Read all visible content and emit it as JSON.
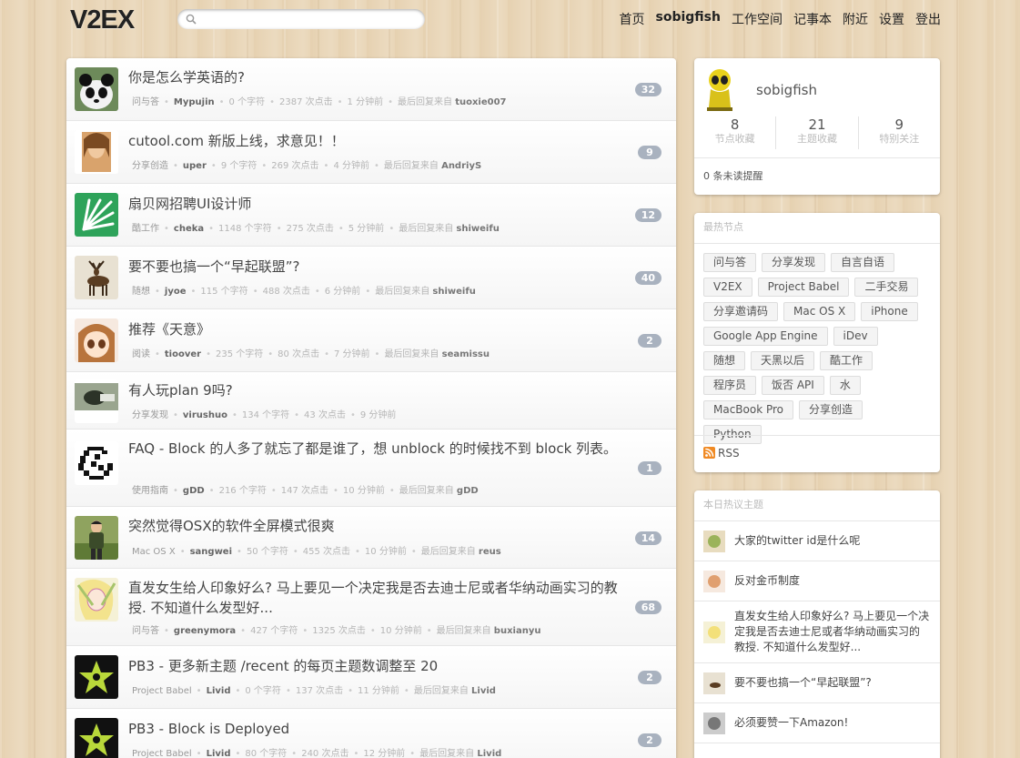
{
  "header": {
    "logo": "V2EX",
    "search_placeholder": "",
    "nav": [
      "首页",
      "sobigfish",
      "工作空间",
      "记事本",
      "附近",
      "设置",
      "登出"
    ]
  },
  "topics": [
    {
      "title": "你是怎么学英语的?",
      "node": "问与答",
      "author": "Mypujin",
      "chars": "0 个字符",
      "clicks": "2387 次点击",
      "time": "1 分钟前",
      "last_label": "最后回复来自",
      "last_user": "tuoxie007",
      "replies": "32"
    },
    {
      "title": "cutool.com 新版上线，求意见！！",
      "node": "分享创造",
      "author": "uper",
      "chars": "9 个字符",
      "clicks": "269 次点击",
      "time": "4 分钟前",
      "last_label": "最后回复来自",
      "last_user": "AndriyS",
      "replies": "9"
    },
    {
      "title": "扇贝网招聘UI设计师",
      "node": "酷工作",
      "author": "cheka",
      "chars": "1148 个字符",
      "clicks": "275 次点击",
      "time": "5 分钟前",
      "last_label": "最后回复来自",
      "last_user": "shiweifu",
      "replies": "12"
    },
    {
      "title": "要不要也搞一个“早起联盟”?",
      "node": "随想",
      "author": "jyoe",
      "chars": "115 个字符",
      "clicks": "488 次点击",
      "time": "6 分钟前",
      "last_label": "最后回复来自",
      "last_user": "shiweifu",
      "replies": "40"
    },
    {
      "title": "推荐《天意》",
      "node": "阅读",
      "author": "tioover",
      "chars": "235 个字符",
      "clicks": "80 次点击",
      "time": "7 分钟前",
      "last_label": "最后回复来自",
      "last_user": "seamissu",
      "replies": "2"
    },
    {
      "title": "有人玩plan 9吗?",
      "node": "分享发现",
      "author": "virushuo",
      "chars": "134 个字符",
      "clicks": "43 次点击",
      "time": "9 分钟前",
      "last_label": "",
      "last_user": "",
      "replies": ""
    },
    {
      "title": "FAQ - Block 的人多了就忘了都是谁了，想 unblock 的时候找不到 block 列表。",
      "node": "使用指南",
      "author": "gDD",
      "chars": "216 个字符",
      "clicks": "147 次点击",
      "time": "10 分钟前",
      "last_label": "最后回复来自",
      "last_user": "gDD",
      "replies": "1"
    },
    {
      "title": "突然觉得OSX的软件全屏模式很爽",
      "node": "Mac OS X",
      "author": "sangwei",
      "chars": "50 个字符",
      "clicks": "455 次点击",
      "time": "10 分钟前",
      "last_label": "最后回复来自",
      "last_user": "reus",
      "replies": "14"
    },
    {
      "title": "直发女生给人印象好么? 马上要见一个决定我是否去迪士尼或者华纳动画实习的教授. 不知道什么发型好...",
      "node": "问与答",
      "author": "greenymora",
      "chars": "427 个字符",
      "clicks": "1325 次点击",
      "time": "10 分钟前",
      "last_label": "最后回复来自",
      "last_user": "buxianyu",
      "replies": "68"
    },
    {
      "title": "PB3 - 更多新主题 /recent 的每页主题数调整至 20",
      "node": "Project Babel",
      "author": "Livid",
      "chars": "0 个字符",
      "clicks": "137 次点击",
      "time": "11 分钟前",
      "last_label": "最后回复来自",
      "last_user": "Livid",
      "replies": "2"
    },
    {
      "title": "PB3 - Block is Deployed",
      "node": "Project Babel",
      "author": "Livid",
      "chars": "80 个字符",
      "clicks": "240 次点击",
      "time": "12 分钟前",
      "last_label": "最后回复来自",
      "last_user": "Livid",
      "replies": "2"
    }
  ],
  "profile": {
    "username": "sobigfish",
    "stats": [
      {
        "value": "8",
        "label": "节点收藏"
      },
      {
        "value": "21",
        "label": "主题收藏"
      },
      {
        "value": "9",
        "label": "特别关注"
      }
    ],
    "notifications": "0 条未读提醒"
  },
  "hot_nodes": {
    "title": "最热节点",
    "tags": [
      "问与答",
      "分享发现",
      "自言自语",
      "V2EX",
      "Project Babel",
      "二手交易",
      "分享邀请码",
      "Mac OS X",
      "iPhone",
      "Google App Engine",
      "iDev",
      "随想",
      "天黑以后",
      "酷工作",
      "程序员",
      "饭否 API",
      "水",
      "MacBook Pro",
      "分享创造",
      "Python"
    ],
    "rss": "RSS"
  },
  "hot_topics": {
    "title": "本日热议主题",
    "items": [
      "大家的twitter id是什么呢",
      "反对金币制度",
      "直发女生给人印象好么? 马上要见一个决定我是否去迪士尼或者华纳动画实习的教授. 不知道什么发型好...",
      "要不要也搞一个“早起联盟”?",
      "必须要赞一下Amazon!"
    ]
  }
}
